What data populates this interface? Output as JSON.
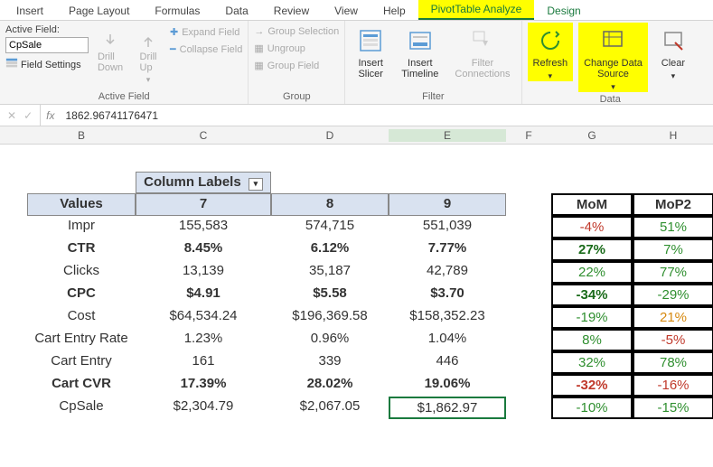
{
  "tabs": {
    "insert": "Insert",
    "page_layout": "Page Layout",
    "formulas": "Formulas",
    "data": "Data",
    "review": "Review",
    "view": "View",
    "help": "Help",
    "pivot_analyze": "PivotTable Analyze",
    "design": "Design"
  },
  "active_field": {
    "label": "Active Field:",
    "value": "CpSale",
    "field_settings": "Field Settings",
    "drill_down": "Drill\nDown",
    "drill_up": "Drill\nUp",
    "expand": "Expand Field",
    "collapse": "Collapse Field",
    "group_label": "Active Field"
  },
  "group": {
    "group_selection": "Group Selection",
    "ungroup": "Ungroup",
    "group_field": "Group Field",
    "group_label": "Group"
  },
  "filter": {
    "insert_slicer": "Insert\nSlicer",
    "insert_timeline": "Insert\nTimeline",
    "filter_connections": "Filter\nConnections",
    "group_label": "Filter"
  },
  "data_group": {
    "refresh": "Refresh",
    "change_source": "Change Data\nSource",
    "clear": "Clear",
    "group_label": "Data"
  },
  "formula_bar": {
    "fx": "fx",
    "value": "1862.96741176471"
  },
  "columns": {
    "B": "B",
    "C": "C",
    "D": "D",
    "E": "E",
    "F": "F",
    "G": "G",
    "H": "H"
  },
  "pivot": {
    "column_labels": "Column Labels",
    "values_label": "Values",
    "col_nums": [
      "7",
      "8",
      "9"
    ],
    "mom": "MoM",
    "mop2": "MoP2",
    "rows": [
      {
        "label": "Impr",
        "bold": false,
        "v": [
          "155,583",
          "574,715",
          "551,039"
        ],
        "mom": "-4%",
        "mom_c": "red",
        "mop": "51%",
        "mop_c": "green"
      },
      {
        "label": "CTR",
        "bold": true,
        "v": [
          "8.45%",
          "6.12%",
          "7.77%"
        ],
        "mom": "27%",
        "mom_c": "darkgreen",
        "mop": "7%",
        "mop_c": "green"
      },
      {
        "label": "Clicks",
        "bold": false,
        "v": [
          "13,139",
          "35,187",
          "42,789"
        ],
        "mom": "22%",
        "mom_c": "green",
        "mop": "77%",
        "mop_c": "green"
      },
      {
        "label": "CPC",
        "bold": true,
        "v": [
          "$4.91",
          "$5.58",
          "$3.70"
        ],
        "mom": "-34%",
        "mom_c": "darkgreen",
        "mop": "-29%",
        "mop_c": "green"
      },
      {
        "label": "Cost",
        "bold": false,
        "v": [
          "$64,534.24",
          "$196,369.58",
          "$158,352.23"
        ],
        "mom": "-19%",
        "mom_c": "green",
        "mop": "21%",
        "mop_c": "orange"
      },
      {
        "label": "Cart Entry Rate",
        "bold": false,
        "v": [
          "1.23%",
          "0.96%",
          "1.04%"
        ],
        "mom": "8%",
        "mom_c": "green",
        "mop": "-5%",
        "mop_c": "red"
      },
      {
        "label": "Cart Entry",
        "bold": false,
        "v": [
          "161",
          "339",
          "446"
        ],
        "mom": "32%",
        "mom_c": "green",
        "mop": "78%",
        "mop_c": "green"
      },
      {
        "label": "Cart CVR",
        "bold": true,
        "v": [
          "17.39%",
          "28.02%",
          "19.06%"
        ],
        "mom": "-32%",
        "mom_c": "red",
        "mop": "-16%",
        "mop_c": "red"
      },
      {
        "label": "CpSale",
        "bold": false,
        "v": [
          "$2,304.79",
          "$2,067.05",
          "$1,862.97"
        ],
        "mom": "-10%",
        "mom_c": "green",
        "mop": "-15%",
        "mop_c": "green"
      }
    ]
  }
}
